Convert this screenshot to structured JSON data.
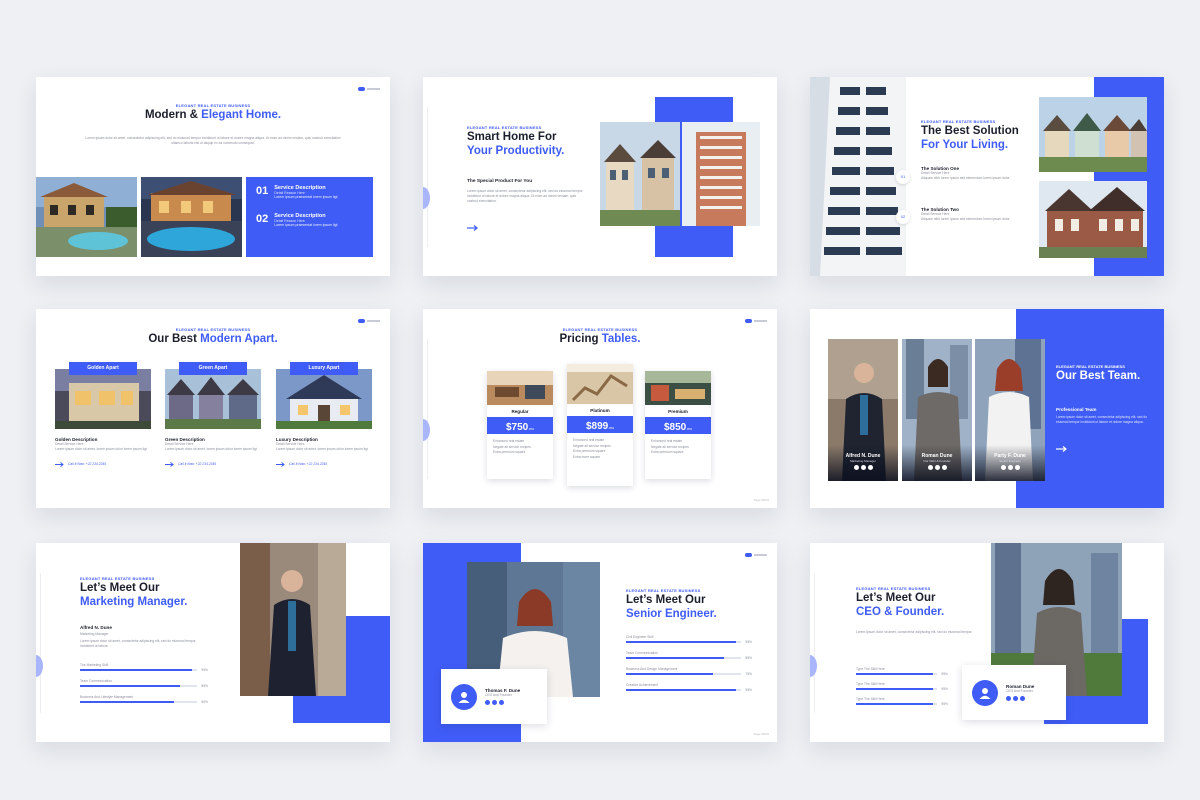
{
  "colors": {
    "accent": "#3f5cf6",
    "background": "#eef0f4"
  },
  "s1": {
    "kicker": "ELEGANT REAL ESTATE BUSINESS",
    "title_a": "Modern &",
    "title_b": "Elegant Home.",
    "body": "Lorem ipsum dolor sit amet, consectetur adipiscing elit, sed do eiusmod tempor incididunt ut labore et dolore magna aliqua. Ut enim ad minim veniam, quis nostrud exercitation ullamco laboris nisi ut aliquip ex ea commodo consequat.",
    "items": [
      {
        "num": "01",
        "title": "Service Description",
        "sub": "Detail Reason Here",
        "text": "Lorem ipsum praesentat lorem ipsum ligt"
      },
      {
        "num": "02",
        "title": "Service Description",
        "sub": "Detail Reason Here",
        "text": "Lorem ipsum praesentat lorem ipsum ligt"
      }
    ]
  },
  "s2": {
    "kicker": "ELEGANT REAL ESTATE BUSINESS",
    "title_a": "Smart Home For",
    "title_b": "Your Productivity.",
    "subhead": "The Special Product For You",
    "body": "Lorem ipsum dolor sit amet, consectetur adipiscing elit, sed do eiusmod tempor incididunt ut labore et dolore magna aliqua. Ut enim ad minim veniam, quis nostrud exercitation."
  },
  "s3": {
    "kicker": "ELEGANT REAL ESTATE BUSINESS",
    "title_a": "The Best Solution",
    "title_b": "For Your Living.",
    "items": [
      {
        "num": "01",
        "title": "The Solution One",
        "sub": "Detail Service Here",
        "text": "Aliquam nibh lorem ipsum sed elementum lorem ipsum dolor"
      },
      {
        "num": "02",
        "title": "The Solution Two",
        "sub": "Detail Service Here",
        "text": "Aliquam nibh lorem ipsum sed elementum lorem ipsum dolor"
      }
    ]
  },
  "s4": {
    "kicker": "ELEGANT REAL ESTATE BUSINESS",
    "title_a": "Our Best",
    "title_b": "Modern Apart.",
    "cards": [
      {
        "tag": "Golden Apart",
        "title": "Golden Description",
        "sub": "Detail Service Here",
        "text": "Lorem ipsum dolor sit amet, lorem ipsum dolor lorem ipsum ligt",
        "cta": "Call It Now: +22 234 2345"
      },
      {
        "tag": "Green Apart",
        "title": "Green Description",
        "sub": "Detail Service Here",
        "text": "Lorem ipsum dolor sit amet, lorem ipsum dolor lorem ipsum ligt",
        "cta": "Call It Now: +22 234 2345"
      },
      {
        "tag": "Luxury Apart",
        "title": "Luxury Description",
        "sub": "Detail Service Here",
        "text": "Lorem ipsum dolor sit amet, lorem ipsum dolor lorem ipsum ligt",
        "cta": "Call It Now: +22 234 2345"
      }
    ]
  },
  "s5": {
    "kicker": "ELEGANT REAL ESTATE BUSINESS",
    "title_a": "Pricing",
    "title_b": "Tables.",
    "cards": [
      {
        "name": "Regular",
        "price": "$750",
        "per": ".mo",
        "features": [
          "Enhanced real estate",
          "Negate all service recipes",
          "Extra premium square"
        ]
      },
      {
        "name": "Platinum",
        "price": "$899",
        "per": ".mo",
        "features": [
          "Enhanced real estate",
          "Negate all service recipes",
          "Extra premium square",
          "Extra more square"
        ]
      },
      {
        "name": "Premium",
        "price": "$850",
        "per": ".mo",
        "features": [
          "Enhanced real estate",
          "Negate all service recipes",
          "Extra premium square"
        ]
      }
    ],
    "footer": "Page 05/10"
  },
  "s6": {
    "kicker": "ELEGANT REAL ESTATE BUSINESS",
    "title": "Our Best Team.",
    "subhead": "Professional Team",
    "body": "Lorem ipsum dolor sit amet, consectetur adipiscing elit, sed do eiusmod tempor incididunt ut labore et dolore magna aliqua.",
    "members": [
      {
        "name": "Alfred N. Dune",
        "role": "Marketing Manager"
      },
      {
        "name": "Roman Dune",
        "role": "Our CEO & Founder"
      },
      {
        "name": "Party F. Dune",
        "role": "Senior Engineer"
      }
    ]
  },
  "s7": {
    "kicker": "ELEGANT REAL ESTATE BUSINESS",
    "title_a": "Let’s Meet Our",
    "title_b": "Marketing Manager.",
    "name": "Alfred N. Dune",
    "role": "Marketing Manager",
    "body": "Lorem ipsum dolor sit amet, consectetur adipiscing elit, sed do eiusmod tempor incididunt ut labore.",
    "skills": [
      {
        "label": "The Marketing Skill",
        "pct": "95%",
        "value": 0.95
      },
      {
        "label": "Team Communication",
        "pct": "85%",
        "value": 0.85
      },
      {
        "label": "Business And Lifestyle Management",
        "pct": "80%",
        "value": 0.8
      }
    ]
  },
  "s8": {
    "kicker": "ELEGANT REAL ESTATE BUSINESS",
    "title_a": "Let’s Meet Our",
    "title_b": "Senior Engineer.",
    "name": "Thomas F. Dune",
    "role": "CEO And Founder",
    "skills": [
      {
        "label": "Civil Engineer Skill",
        "pct": "95%",
        "value": 0.95
      },
      {
        "label": "Team Communication",
        "pct": "85%",
        "value": 0.85
      },
      {
        "label": "Business And Design Management",
        "pct": "75%",
        "value": 0.75
      },
      {
        "label": "Creative Achievement",
        "pct": "95%",
        "value": 0.95
      }
    ],
    "footer": "Page 08/10"
  },
  "s9": {
    "kicker": "ELEGANT REAL ESTATE BUSINESS",
    "title_a": "Let’s Meet Our",
    "title_b": "CEO & Founder.",
    "name": "Roman Dune",
    "role": "CEO And Founder",
    "body": "Lorem ipsum dolor sit amet, consectetur adipiscing elit, sed do eiusmod tempor.",
    "skills": [
      {
        "label": "Type The Skill Here",
        "pct": "95%",
        "value": 0.95
      },
      {
        "label": "Type The Skill Here",
        "pct": "95%",
        "value": 0.95
      },
      {
        "label": "Type The Skill Here",
        "pct": "95%",
        "value": 0.95
      }
    ]
  }
}
